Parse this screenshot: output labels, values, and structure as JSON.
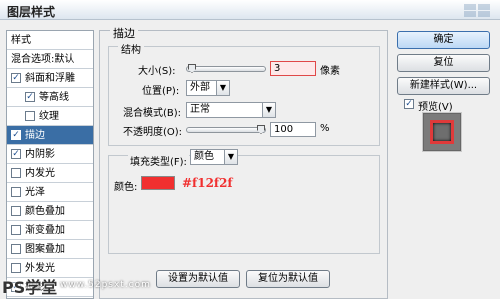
{
  "window": {
    "title": "图层样式"
  },
  "left_panel": {
    "items": [
      {
        "label": "样式",
        "checkbox": false,
        "checked": false,
        "selected": false,
        "indent": false
      },
      {
        "label": "混合选项:默认",
        "checkbox": false,
        "checked": false,
        "selected": false,
        "indent": false
      },
      {
        "label": "斜面和浮雕",
        "checkbox": true,
        "checked": true,
        "selected": false,
        "indent": false
      },
      {
        "label": "等高线",
        "checkbox": true,
        "checked": true,
        "selected": false,
        "indent": true
      },
      {
        "label": "纹理",
        "checkbox": true,
        "checked": false,
        "selected": false,
        "indent": true
      },
      {
        "label": "描边",
        "checkbox": true,
        "checked": true,
        "selected": true,
        "indent": false
      },
      {
        "label": "内阴影",
        "checkbox": true,
        "checked": true,
        "selected": false,
        "indent": false
      },
      {
        "label": "内发光",
        "checkbox": true,
        "checked": false,
        "selected": false,
        "indent": false
      },
      {
        "label": "光泽",
        "checkbox": true,
        "checked": false,
        "selected": false,
        "indent": false
      },
      {
        "label": "颜色叠加",
        "checkbox": true,
        "checked": false,
        "selected": false,
        "indent": false
      },
      {
        "label": "渐变叠加",
        "checkbox": true,
        "checked": false,
        "selected": false,
        "indent": false
      },
      {
        "label": "图案叠加",
        "checkbox": true,
        "checked": false,
        "selected": false,
        "indent": false
      },
      {
        "label": "外发光",
        "checkbox": true,
        "checked": false,
        "selected": false,
        "indent": false
      },
      {
        "label": "投影",
        "checkbox": true,
        "checked": true,
        "selected": false,
        "indent": false
      }
    ]
  },
  "stroke": {
    "group_title": "描边",
    "structure_title": "结构",
    "size_label": "大小(S):",
    "size_value": "3",
    "size_unit": "像素",
    "size_level": 0.02,
    "position_label": "位置(P):",
    "position_value": "外部",
    "blend_label": "混合模式(B):",
    "blend_value": "正常",
    "opacity_label": "不透明度(O):",
    "opacity_value": "100",
    "opacity_unit": "%",
    "opacity_level": 1.0,
    "fill_type_label": "填充类型(F):",
    "fill_type_value": "颜色",
    "color_label": "颜色:",
    "color_value": "#f12f2f",
    "set_default_label": "设置为默认值",
    "reset_default_label": "复位为默认值"
  },
  "right": {
    "ok_label": "确定",
    "reset_label": "复位",
    "new_style_label": "新建样式(W)...",
    "preview_label": "预览(V)",
    "preview_checked": true
  },
  "watermark": {
    "big": "PS学堂",
    "site": "www.52psxt.com"
  },
  "colors": {
    "accent": "#3a6ea5",
    "stroke": "#f12f2f"
  }
}
